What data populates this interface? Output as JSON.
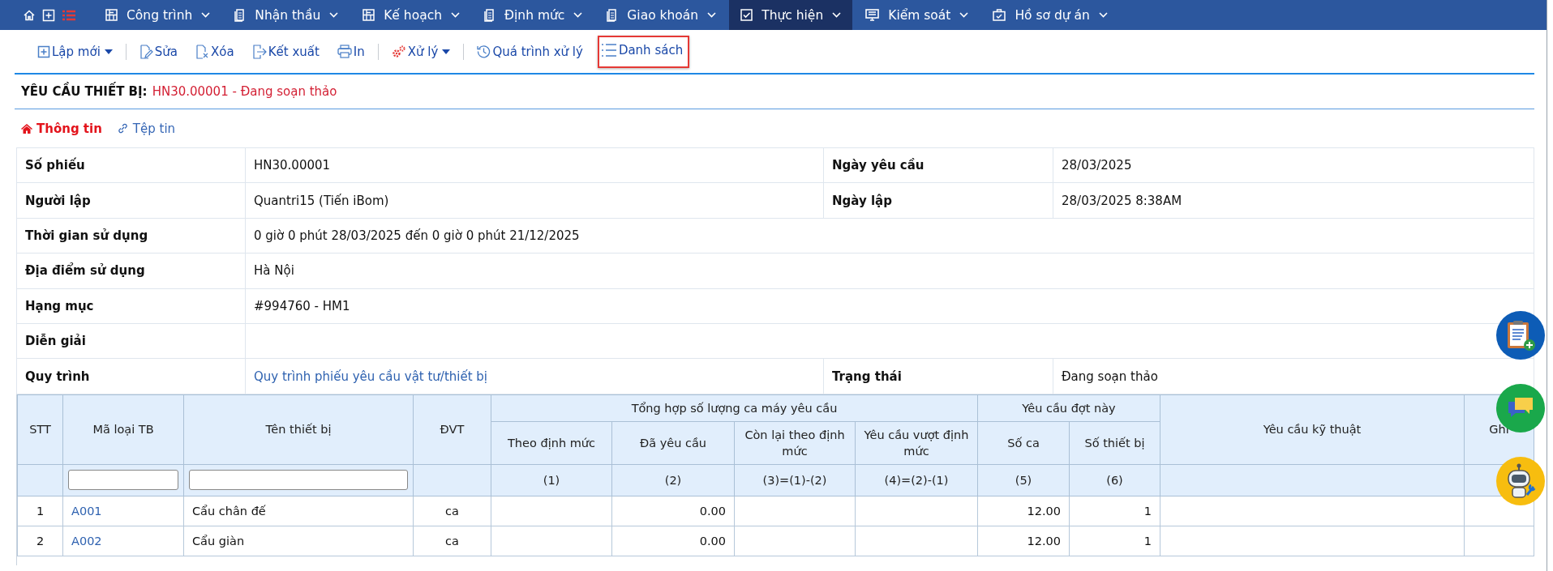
{
  "nav": [
    {
      "label": "Công trình",
      "selected": false
    },
    {
      "label": "Nhận thầu",
      "selected": false
    },
    {
      "label": "Kế hoạch",
      "selected": false
    },
    {
      "label": "Định mức",
      "selected": false
    },
    {
      "label": "Giao khoán",
      "selected": false
    },
    {
      "label": "Thực hiện",
      "selected": true
    },
    {
      "label": "Kiểm soát",
      "selected": false
    },
    {
      "label": "Hồ sơ dự án",
      "selected": false
    }
  ],
  "toolbar": [
    {
      "buttons": [
        {
          "label": "Lập mới",
          "dropdown": true,
          "highlighted": false
        }
      ]
    },
    {
      "buttons": [
        {
          "label": "Sửa",
          "dropdown": false,
          "highlighted": false
        },
        {
          "label": "Xóa",
          "dropdown": false,
          "highlighted": false
        },
        {
          "label": "Kết xuất",
          "dropdown": false,
          "highlighted": false
        },
        {
          "label": "In",
          "dropdown": false,
          "highlighted": false
        }
      ]
    },
    {
      "buttons": [
        {
          "label": "Xử lý",
          "dropdown": true,
          "highlighted": false
        }
      ]
    },
    {
      "buttons": [
        {
          "label": "Quá trình xử lý",
          "dropdown": false,
          "highlighted": false
        },
        {
          "label": "Danh sách",
          "dropdown": false,
          "highlighted": true
        }
      ]
    }
  ],
  "title": {
    "label": "YÊU CẦU THIẾT BỊ:",
    "value": "HN30.00001 - Đang soạn thảo"
  },
  "tabs": [
    {
      "label": "Thông tin",
      "selected": true
    },
    {
      "label": "Tệp tin",
      "selected": false
    }
  ],
  "info": [
    {
      "cells": [
        {
          "label": "Số phiếu",
          "value": "HN30.00001"
        },
        {
          "label": "Ngày yêu cầu",
          "value": "28/03/2025"
        }
      ]
    },
    {
      "cells": [
        {
          "label": "Người lập",
          "value": "Quantri15 (Tiến iBom)"
        },
        {
          "label": "Ngày lập",
          "value": "28/03/2025 8:38AM"
        }
      ]
    },
    {
      "cells": [
        {
          "label": "Thời gian sử dụng",
          "value": "0 giờ 0 phút 28/03/2025 đến 0 giờ 0 phút 21/12/2025"
        }
      ]
    },
    {
      "cells": [
        {
          "label": "Địa điểm sử dụng",
          "value": "Hà Nội"
        }
      ]
    },
    {
      "cells": [
        {
          "label": "Hạng mục",
          "value": "#994760 - HM1"
        }
      ]
    },
    {
      "cells": [
        {
          "label": "Diễn giải"
        }
      ]
    },
    {
      "cells": [
        {
          "label": "Quy trình",
          "value": "Quy trình phiếu yêu cầu vật tư/thiết bị",
          "link": true
        },
        {
          "label": "Trạng thái",
          "value": "Đang soạn thảo"
        }
      ]
    }
  ],
  "items_table": {
    "columns": [
      {
        "kind": "single",
        "label": "STT",
        "filter": false
      },
      {
        "kind": "single",
        "label": "Mã loại TB",
        "filter": true
      },
      {
        "kind": "single",
        "label": "Tên thiết bị",
        "filter": true
      },
      {
        "kind": "single",
        "label": "ĐVT",
        "filter": false
      },
      {
        "kind": "group",
        "label": "Tổng hợp số lượng ca máy yêu cầu",
        "columns": [
          {
            "label": "Theo định mức",
            "formula": "(1)"
          },
          {
            "label": "Đã yêu cầu",
            "formula": "(2)"
          },
          {
            "label": "Còn lại theo định mức",
            "formula": "(3)=(1)-(2)"
          },
          {
            "label": "Yêu cầu vượt định mức",
            "formula": "(4)=(2)-(1)"
          }
        ]
      },
      {
        "kind": "group",
        "label": "Yêu cầu đợt này",
        "columns": [
          {
            "label": "Số ca",
            "formula": "(5)"
          },
          {
            "label": "Số thiết bị",
            "formula": "(6)"
          }
        ]
      },
      {
        "kind": "single",
        "label": "Yêu cầu kỹ thuật",
        "filter": false
      },
      {
        "kind": "single",
        "label": "Ghi",
        "filter": false
      }
    ],
    "rows": [
      {
        "stt": "1",
        "code": "A001",
        "name": "Cẩu chân đế",
        "unit": "ca",
        "requested": "0.00",
        "shifts": "12.00",
        "devices": "1"
      },
      {
        "stt": "2",
        "code": "A002",
        "name": "Cẩu giàn",
        "unit": "ca",
        "requested": "0.00",
        "shifts": "12.00",
        "devices": "1"
      }
    ]
  }
}
